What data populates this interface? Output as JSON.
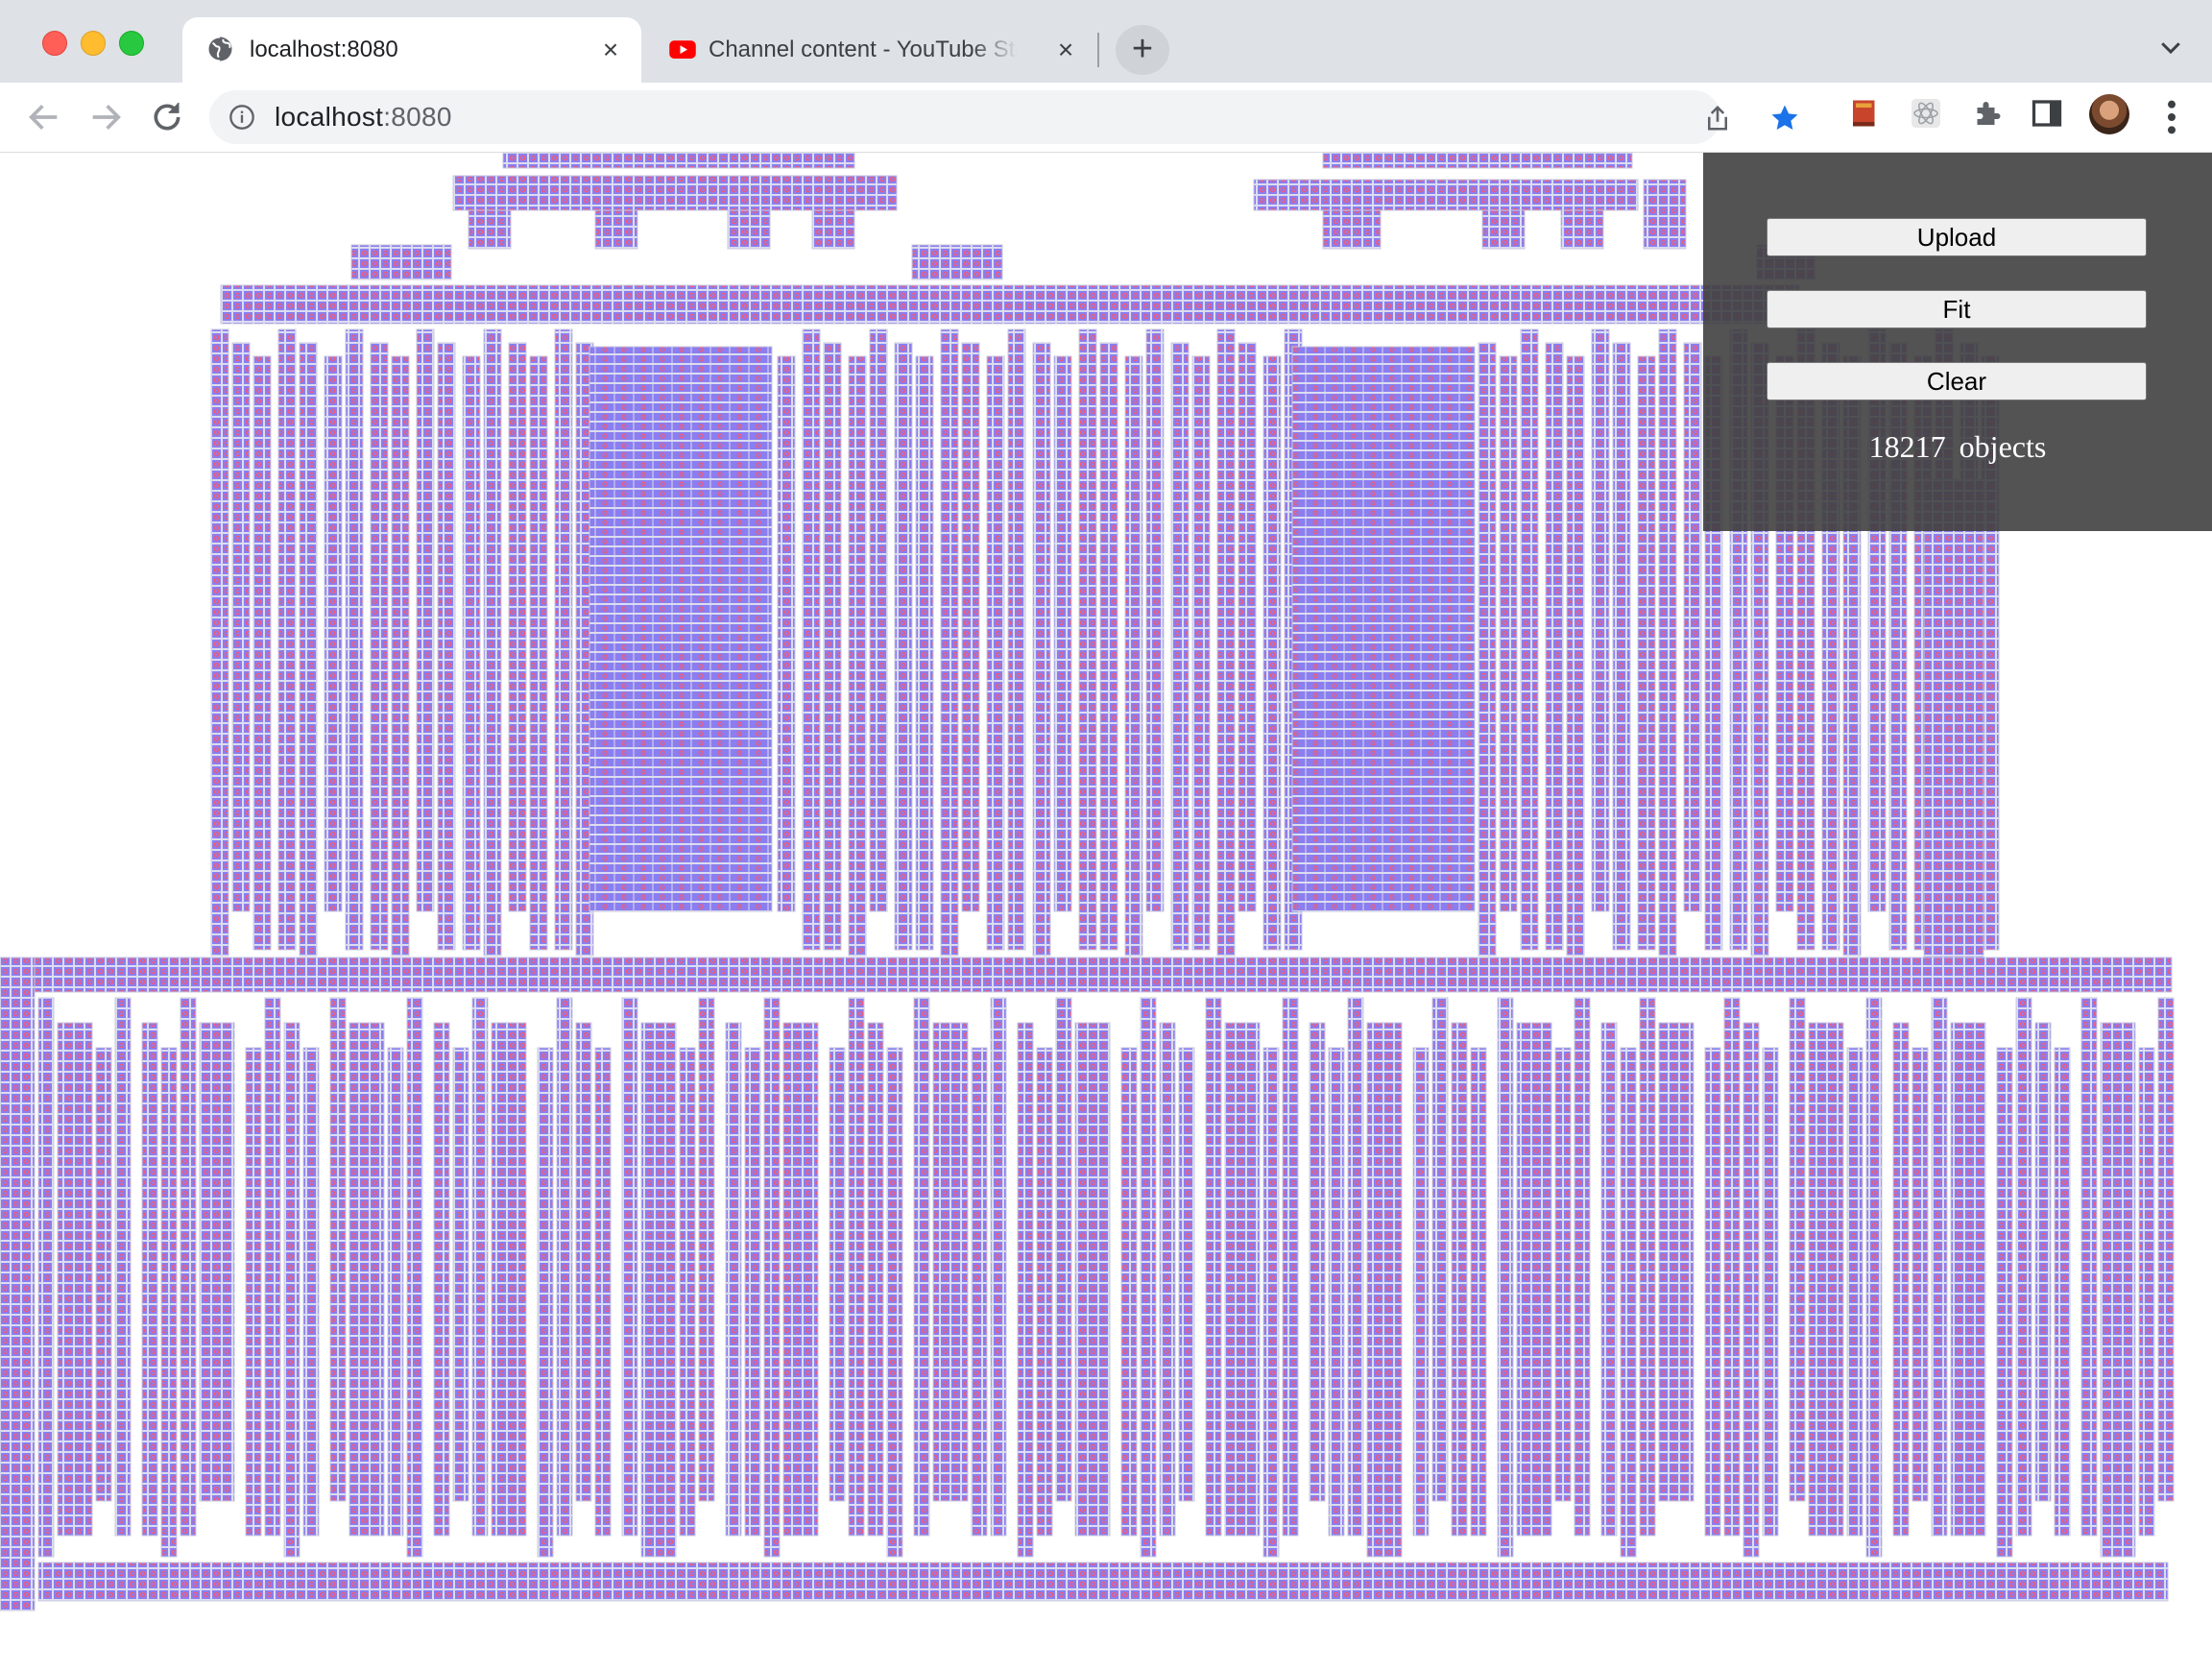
{
  "window": {
    "tabs": [
      {
        "title": "localhost:8080",
        "icon": "globe-icon",
        "active": true
      },
      {
        "title": "Channel content - YouTube Studio",
        "icon": "youtube-icon",
        "active": false
      }
    ]
  },
  "toolbar": {
    "url_host": "localhost",
    "url_port": ":8080",
    "bookmarked": true
  },
  "panel": {
    "upload_label": "Upload",
    "fit_label": "Fit",
    "clear_label": "Clear",
    "object_count": "18217",
    "object_label": "objects"
  },
  "colors": {
    "cell_fill": "#8a7ef0",
    "cell_stroke": "#dcdcf0",
    "pin": "#f05a78",
    "panel_bg": "#404040",
    "star": "#1a73e8"
  }
}
